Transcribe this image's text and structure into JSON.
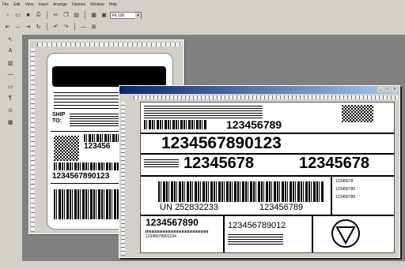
{
  "menu": {
    "items": [
      "File",
      "Edit",
      "View",
      "Insert",
      "Arrange",
      "Options",
      "Window",
      "Help"
    ]
  },
  "toolbar": {
    "zoom_value": "Fit 100",
    "buttons": [
      "new-icon",
      "open-icon",
      "save-icon",
      "print-icon",
      "cut-icon",
      "copy-icon",
      "paste-icon",
      "undo-icon",
      "redo-icon",
      "zoom-icon"
    ]
  },
  "left_tools": [
    "pointer-icon",
    "text-icon",
    "barcode-icon",
    "line-icon",
    "rectangle-icon",
    "image-icon",
    "rfid-icon",
    "table-icon"
  ],
  "label_back": {
    "ship_to_label": "SHIP TO:",
    "barcode_number_1": "123456",
    "barcode_number_2": "1234567890123"
  },
  "label_front": {
    "number_top": "123456789",
    "number_big": "1234567890123",
    "number_mid_left": "12345678",
    "number_mid_right": "12345678",
    "un_number": "UN  252832233",
    "un_number_right": "123456789",
    "number_bottom_left": "1234567890",
    "number_bottom_sub": "12345678901234",
    "number_bottom_mid": "123456789012",
    "right_box_text_1": "12345678",
    "right_box_text_2": "123456789",
    "right_box_text_3": "123456789"
  },
  "colors": {
    "titlebar_start": "#0a246a",
    "titlebar_end": "#a6caf0",
    "workspace": "#808080"
  }
}
